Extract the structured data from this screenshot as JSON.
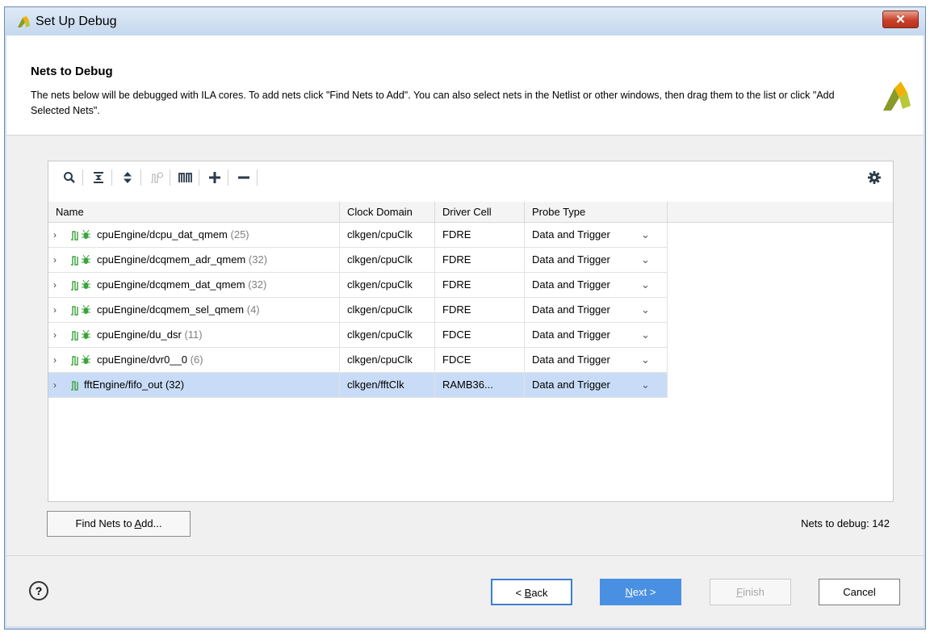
{
  "window": {
    "title": "Set Up Debug",
    "close_label": "✕"
  },
  "header": {
    "title": "Nets to Debug",
    "description": "The nets below will be debugged with ILA cores. To add nets click \"Find Nets to Add\". You can also select nets in the Netlist or other windows, then drag them to the list or click \"Add Selected Nets\"."
  },
  "toolbar": {
    "icons": [
      "search-icon",
      "collapse-all-icon",
      "expand-all-icon",
      "clock-icon",
      "bus-icon",
      "add-icon",
      "remove-icon",
      "settings-icon"
    ]
  },
  "table": {
    "columns": [
      "Name",
      "Clock Domain",
      "Driver Cell",
      "Probe Type"
    ],
    "rows": [
      {
        "name": "cpuEngine/dcpu_dat_qmem",
        "count": "(25)",
        "clock": "clkgen/cpuClk",
        "driver": "FDRE",
        "probe": "Data and Trigger",
        "bug": true,
        "selected": false
      },
      {
        "name": "cpuEngine/dcqmem_adr_qmem",
        "count": "(32)",
        "clock": "clkgen/cpuClk",
        "driver": "FDRE",
        "probe": "Data and Trigger",
        "bug": true,
        "selected": false
      },
      {
        "name": "cpuEngine/dcqmem_dat_qmem",
        "count": "(32)",
        "clock": "clkgen/cpuClk",
        "driver": "FDRE",
        "probe": "Data and Trigger",
        "bug": true,
        "selected": false
      },
      {
        "name": "cpuEngine/dcqmem_sel_qmem",
        "count": "(4)",
        "clock": "clkgen/cpuClk",
        "driver": "FDRE",
        "probe": "Data and Trigger",
        "bug": true,
        "selected": false
      },
      {
        "name": "cpuEngine/du_dsr",
        "count": "(11)",
        "clock": "clkgen/cpuClk",
        "driver": "FDCE",
        "probe": "Data and Trigger",
        "bug": true,
        "selected": false
      },
      {
        "name": "cpuEngine/dvr0__0",
        "count": "(6)",
        "clock": "clkgen/cpuClk",
        "driver": "FDCE",
        "probe": "Data and Trigger",
        "bug": true,
        "selected": false
      },
      {
        "name": "fftEngine/fifo_out",
        "count": "(32)",
        "clock": "clkgen/fftClk",
        "driver": "RAMB36...",
        "probe": "Data and Trigger",
        "bug": false,
        "selected": true
      }
    ]
  },
  "actions": {
    "find_nets_label": "Find Nets to Add...",
    "find_nets_prefix": "Find Nets to ",
    "find_nets_mnemonic": "A",
    "find_nets_suffix": "dd...",
    "nets_to_debug": "Nets to debug: 142"
  },
  "footer": {
    "help_label": "?",
    "back_prefix": "< ",
    "back_mnemonic": "B",
    "back_suffix": "ack",
    "next_mnemonic": "N",
    "next_suffix": "ext >",
    "finish_mnemonic": "F",
    "finish_suffix": "inish",
    "cancel_label": "Cancel"
  },
  "colors": {
    "accent": "#4a90e2",
    "selected_row": "#c9dcf7",
    "net_icon": "#4caf50",
    "close_button": "#c9412a"
  }
}
